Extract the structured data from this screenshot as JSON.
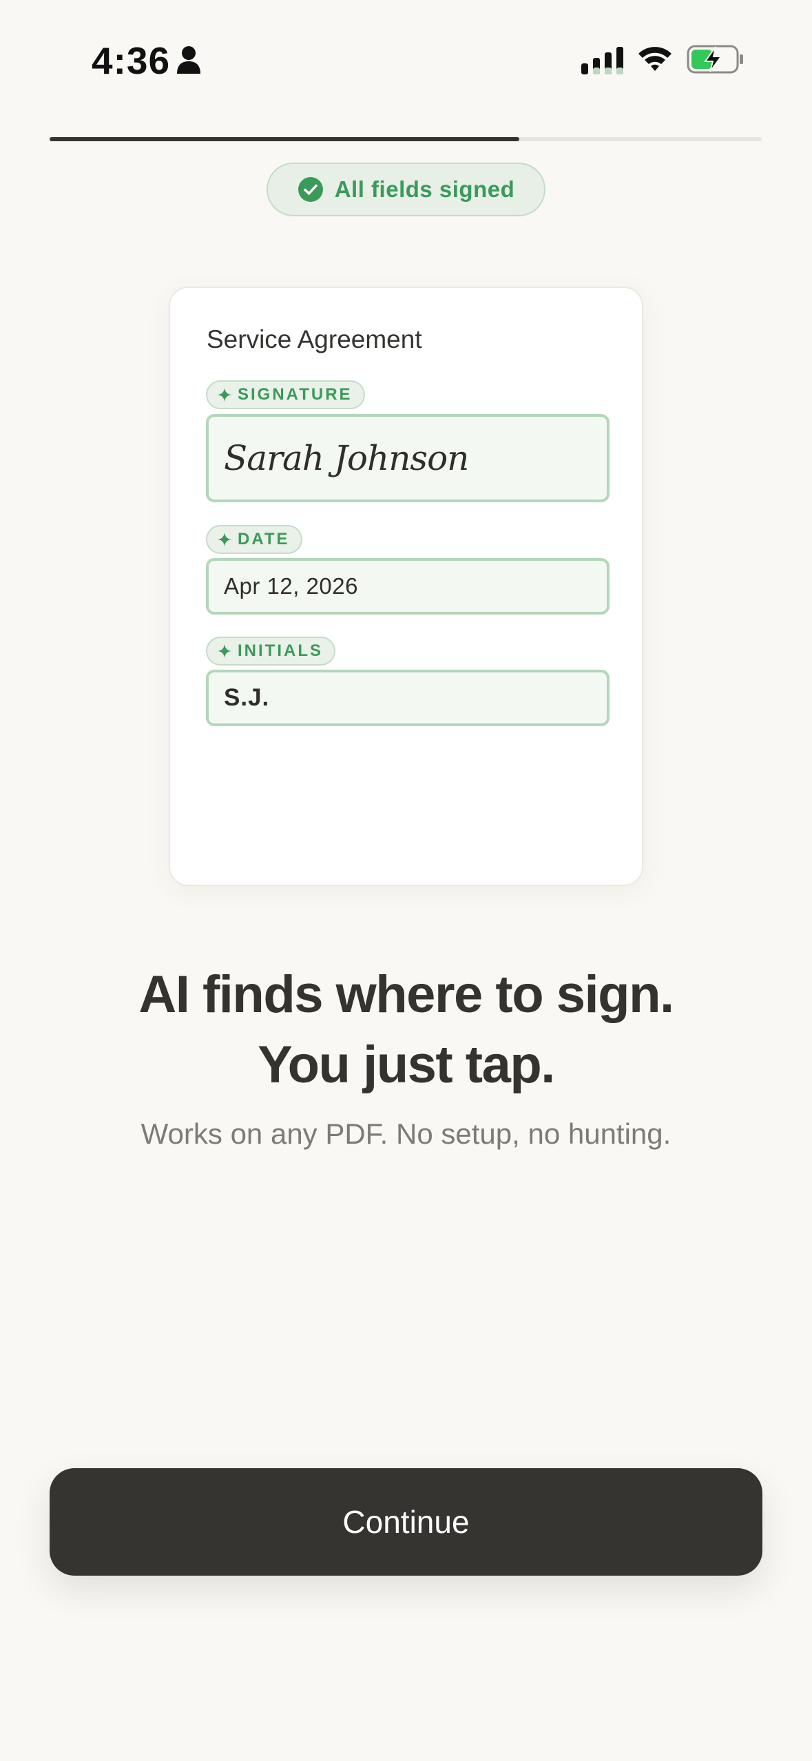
{
  "status_bar": {
    "time": "4:36",
    "icons": [
      "person-icon",
      "cellular-signal-icon",
      "wifi-icon",
      "battery-charging-icon"
    ]
  },
  "progress": {
    "value": 0.66
  },
  "badge": {
    "text": "All fields signed",
    "icon": "check-circle-icon",
    "color": "#3a9a5a"
  },
  "document": {
    "title": "Service Agreement",
    "fields": [
      {
        "tag": "SIGNATURE",
        "value": "Sarah Johnson"
      },
      {
        "tag": "DATE",
        "value": "Apr 12, 2026"
      },
      {
        "tag": "INITIALS",
        "value": "S.J."
      }
    ]
  },
  "headline": {
    "line1": "AI finds where to sign.",
    "line2": "You just tap."
  },
  "subtext": "Works on any PDF. No setup, no hunting.",
  "continue_label": "Continue",
  "colors": {
    "accent_green": "#3a9a5a",
    "dark": "#353430",
    "background": "#f9f8f4"
  }
}
